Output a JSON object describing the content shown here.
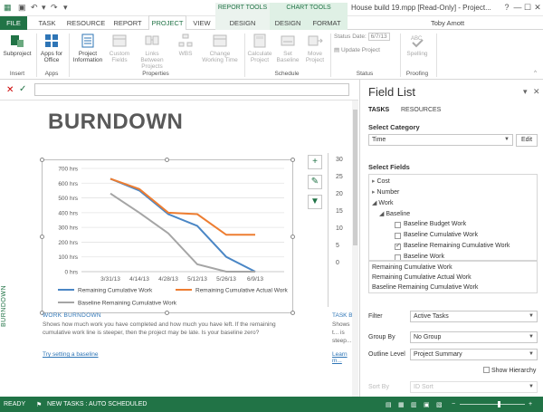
{
  "window": {
    "title": "House build 19.mpp [Read-Only] - Project...",
    "user": "Toby Amott",
    "tool_headers": {
      "report": "REPORT TOOLS",
      "chart": "CHART TOOLS"
    },
    "controls": {
      "help": "?",
      "minimize": "—",
      "maximize": "☐",
      "close": "✕"
    }
  },
  "tabs": [
    {
      "label": "FILE"
    },
    {
      "label": "TASK"
    },
    {
      "label": "RESOURCE"
    },
    {
      "label": "REPORT"
    },
    {
      "label": "PROJECT"
    },
    {
      "label": "VIEW"
    },
    {
      "label": "DESIGN"
    },
    {
      "label": "DESIGN"
    },
    {
      "label": "FORMAT"
    }
  ],
  "ribbon": {
    "subproject": "Subproject",
    "apps_for_office": "Apps for Office",
    "project_information": "Project Information",
    "custom_fields": "Custom Fields",
    "links_between_projects": "Links Between Projects",
    "wbs": "WBS",
    "change_working_time": "Change Working Time",
    "calculate_project": "Calculate Project",
    "set_baseline": "Set Baseline",
    "move_project": "Move Project",
    "status_date_label": "Status Date:",
    "status_date_value": "6/7/13",
    "update_project": "Update Project",
    "spelling": "Spelling",
    "groups": {
      "insert": "Insert",
      "apps": "Apps",
      "properties": "Properties",
      "schedule": "Schedule",
      "status": "Status",
      "proofing": "Proofing"
    }
  },
  "report": {
    "vertical_label": "BURNDOWN",
    "title": "BURNDOWN",
    "work_burndown_title": "WORK BURNDOWN",
    "work_burndown_desc": "Shows how much work you have completed and how much you have left. If the remaining cumulative work line is steeper, then the project may be late. Is your baseline zero?",
    "work_burndown_link": "Try setting a baseline",
    "task_title": "TASK B...",
    "task_desc": "Shows t... is steep...",
    "task_link": "Learn m..."
  },
  "chart_data": {
    "type": "line",
    "categories": [
      "3/31/13",
      "4/14/13",
      "4/28/13",
      "5/12/13",
      "5/26/13",
      "6/9/13"
    ],
    "x": [
      0,
      1,
      2,
      3,
      4,
      5,
      6,
      7
    ],
    "x_label_positions": [
      1,
      2,
      3,
      4,
      5,
      6
    ],
    "yticks": [
      "0 hrs",
      "100 hrs",
      "200 hrs",
      "300 hrs",
      "400 hrs",
      "500 hrs",
      "600 hrs",
      "700 hrs"
    ],
    "ylim": [
      0,
      700
    ],
    "series": [
      {
        "name": "Remaining Cumulative Work",
        "color": "#4a86c5",
        "values": [
          null,
          630,
          550,
          390,
          310,
          100,
          0,
          null
        ]
      },
      {
        "name": "Remaining Cumulative Actual Work",
        "color": "#ed7d31",
        "values": [
          null,
          630,
          560,
          400,
          390,
          250,
          250,
          null
        ]
      },
      {
        "name": "Baseline Remaining Cumulative Work",
        "color": "#a5a5a5",
        "values": [
          null,
          530,
          400,
          260,
          50,
          0,
          0,
          null
        ]
      }
    ],
    "secondary_axis_ticks": [
      "30",
      "25",
      "20",
      "15",
      "10",
      "5",
      "0"
    ]
  },
  "field_list": {
    "title": "Field List",
    "tabs": [
      "TASKS",
      "RESOURCES"
    ],
    "select_category_label": "Select Category",
    "category_value": "Time",
    "edit_label": "Edit",
    "select_fields_label": "Select Fields",
    "tree": [
      {
        "label": "Cost",
        "level": 1,
        "marker": "▸"
      },
      {
        "label": "Number",
        "level": 1,
        "marker": "▸"
      },
      {
        "label": "Work",
        "level": 1,
        "marker": "◢"
      },
      {
        "label": "Baseline",
        "level": 2,
        "marker": "◢"
      },
      {
        "label": "Baseline Budget Work",
        "level": 3,
        "checked": false
      },
      {
        "label": "Baseline Cumulative Work",
        "level": 3,
        "checked": false
      },
      {
        "label": "Baseline Remaining Cumulative Work",
        "level": 3,
        "checked": true
      },
      {
        "label": "Baseline Work",
        "level": 3,
        "checked": false
      }
    ],
    "selected_fields": [
      "Remaining Cumulative Work",
      "Remaining Cumulative Actual Work",
      "Baseline Remaining Cumulative Work"
    ],
    "filter_label": "Filter",
    "filter_value": "Active Tasks",
    "group_by_label": "Group By",
    "group_by_value": "No Group",
    "outline_level_label": "Outline Level",
    "outline_level_value": "Project Summary",
    "show_hierarchy_label": "Show Hierarchy",
    "sort_by_label": "Sort By",
    "sort_by_value": "ID Sort"
  },
  "statusbar": {
    "ready": "READY",
    "new_tasks": "NEW TASKS : AUTO SCHEDULED"
  },
  "colors": {
    "accent": "#217346"
  }
}
